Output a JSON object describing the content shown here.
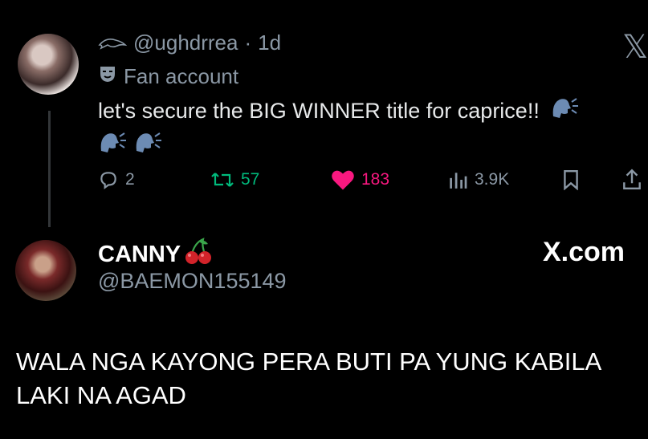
{
  "tweet": {
    "handle": "@ughdrrea",
    "time": "1d",
    "fan_label": "Fan account",
    "text": "let's secure the BIG WINNER title for caprice!!",
    "replies": "2",
    "retweets": "57",
    "likes": "183",
    "views": "3.9K"
  },
  "reply": {
    "name": "CANNY",
    "handle": "@BAEMON155149",
    "brand": "X.com",
    "text": "WALA NGA KAYONG PERA BUTI PA YUNG KABILA LAKI NA AGAD"
  },
  "colors": {
    "retweet": "#00ba7c",
    "like": "#f91880",
    "muted": "#8b98a5"
  }
}
